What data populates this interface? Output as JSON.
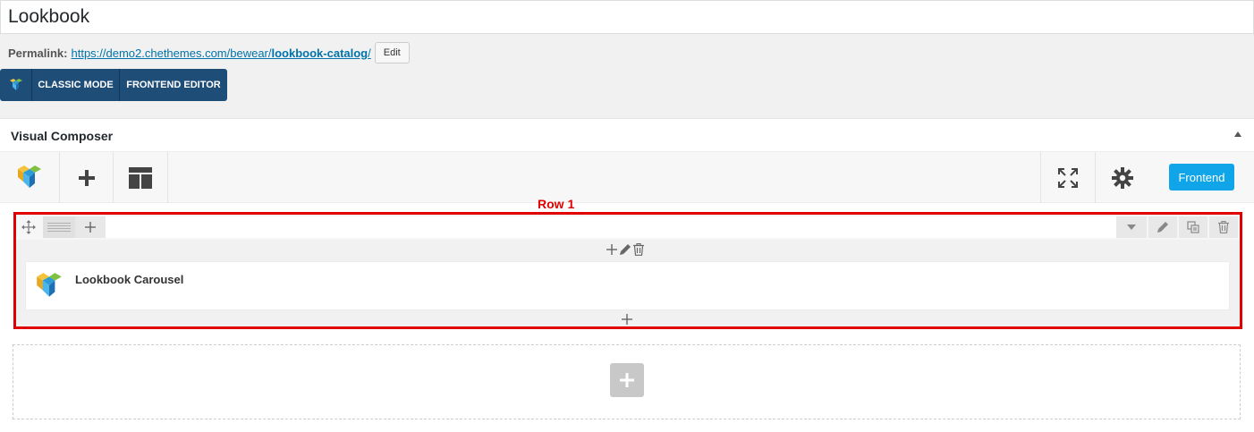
{
  "post_title": "Lookbook",
  "permalink": {
    "label": "Permalink:",
    "url_prefix": "https://demo2.chethemes.com/bewear/",
    "slug": "lookbook-catalog",
    "url_suffix": "/",
    "edit_label": "Edit"
  },
  "mode_bar": {
    "classic_label": "CLASSIC MODE",
    "frontend_editor_label": "FRONTEND EDITOR"
  },
  "vc_panel": {
    "title": "Visual Composer",
    "frontend_label": "Frontend"
  },
  "annotation": {
    "row_label": "Row 1",
    "color": "#e00000"
  },
  "row": {
    "element_name": "Lookbook Carousel"
  },
  "colors": {
    "brand_dark": "#1e4d78",
    "frontend_button": "#0fa5e8",
    "link": "#0073aa"
  },
  "icons": {
    "vc_logo": "vc-logo-icon",
    "add": "plus-icon",
    "templates": "layout-icon",
    "fullscreen": "fullscreen-icon",
    "settings": "gear-icon",
    "move": "move-icon",
    "layout": "row-layout-icon",
    "toggle": "chevron-down-icon",
    "edit": "pencil-icon",
    "clone": "clone-icon",
    "delete": "trash-icon"
  }
}
